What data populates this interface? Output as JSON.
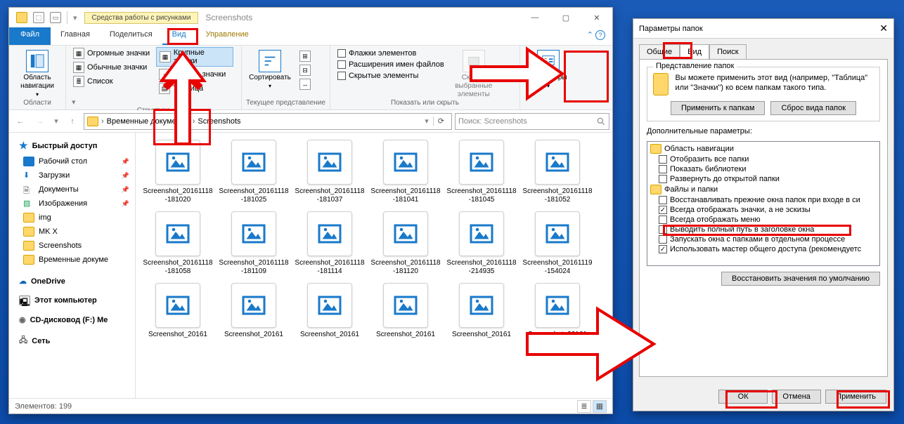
{
  "explorer": {
    "tool_context": "Средства работы с рисунками",
    "title": "Screenshots",
    "file_tab": "Файл",
    "tabs": {
      "home": "Главная",
      "share": "Поделиться",
      "view": "Вид",
      "manage": "Управление"
    },
    "ribbon": {
      "panes": {
        "btn_title": "Область навигации",
        "caption": "Области"
      },
      "layout": {
        "huge": "Огромные значки",
        "large": "Крупные значки",
        "normal": "Обычные значки",
        "small": "Мелкие значки",
        "list": "Список",
        "table": "Таблица",
        "caption": "Структура"
      },
      "current": {
        "sort": "Сортировать",
        "caption": "Текущее представление"
      },
      "showhide": {
        "c1": "Флажки элементов",
        "c2": "Расширения имен файлов",
        "c3": "Скрытые элементы",
        "hide_btn": "Скрыть выбранные элементы",
        "caption": "Показать или скрыть"
      },
      "options": "Параметры"
    },
    "breadcrumbs": {
      "a": "Временные документы",
      "b": "Screenshots"
    },
    "search_placeholder": "Поиск: Screenshots",
    "sidebar": {
      "quick": "Быстрый доступ",
      "desktop": "Рабочий стол",
      "downloads": "Загрузки",
      "documents": "Документы",
      "pictures": "Изображения",
      "img": "img",
      "mkx": "MK X",
      "screens": "Screenshots",
      "temp": "Временные докуме",
      "onedrive": "OneDrive",
      "thispc": "Этот компьютер",
      "cd": "CD-дисковод (F:) Me",
      "network": "Сеть"
    },
    "files": [
      "Screenshot_20161118-181020",
      "Screenshot_20161118-181025",
      "Screenshot_20161118-181037",
      "Screenshot_20161118-181041",
      "Screenshot_20161118-181045",
      "Screenshot_20161118-181052",
      "Screenshot_20161118-181058",
      "Screenshot_20161118-181109",
      "Screenshot_20161118-181114",
      "Screenshot_20161118-181120",
      "Screenshot_20161118-214935",
      "Screenshot_20161119-154024",
      "Screenshot_20161",
      "Screenshot_20161",
      "Screenshot_20161",
      "Screenshot_20161",
      "Screenshot_20161",
      "Screenshot_20161"
    ],
    "status": "Элементов: 199"
  },
  "dialog": {
    "title": "Параметры папок",
    "tabs": {
      "general": "Общие",
      "view": "Вид",
      "search": "Поиск"
    },
    "group1_title": "Представление папок",
    "repr_text": "Вы можете применить этот вид (например, \"Таблица\" или \"Значки\") ко всем папкам такого типа.",
    "apply_to": "Применить к папкам",
    "reset_view": "Сброс вида папок",
    "adv_label": "Дополнительные параметры:",
    "tree": {
      "nav": "Область навигации",
      "n1": "Отобразить все папки",
      "n2": "Показать библиотеки",
      "n3": "Развернуть до открытой папки",
      "files": "Файлы и папки",
      "f1": "Восстанавливать прежние окна папок при входе в си",
      "f2": "Всегда отображать значки, а не эскизы",
      "f3": "Всегда отображать меню",
      "f4": "Выводить полный путь в заголовке окна",
      "f5": "Запускать окна с папками в отдельном процессе",
      "f6": "Использовать мастер общего доступа (рекомендуетс"
    },
    "restore": "Восстановить значения по умолчанию",
    "ok": "ОК",
    "cancel": "Отмена",
    "apply": "Применить"
  }
}
